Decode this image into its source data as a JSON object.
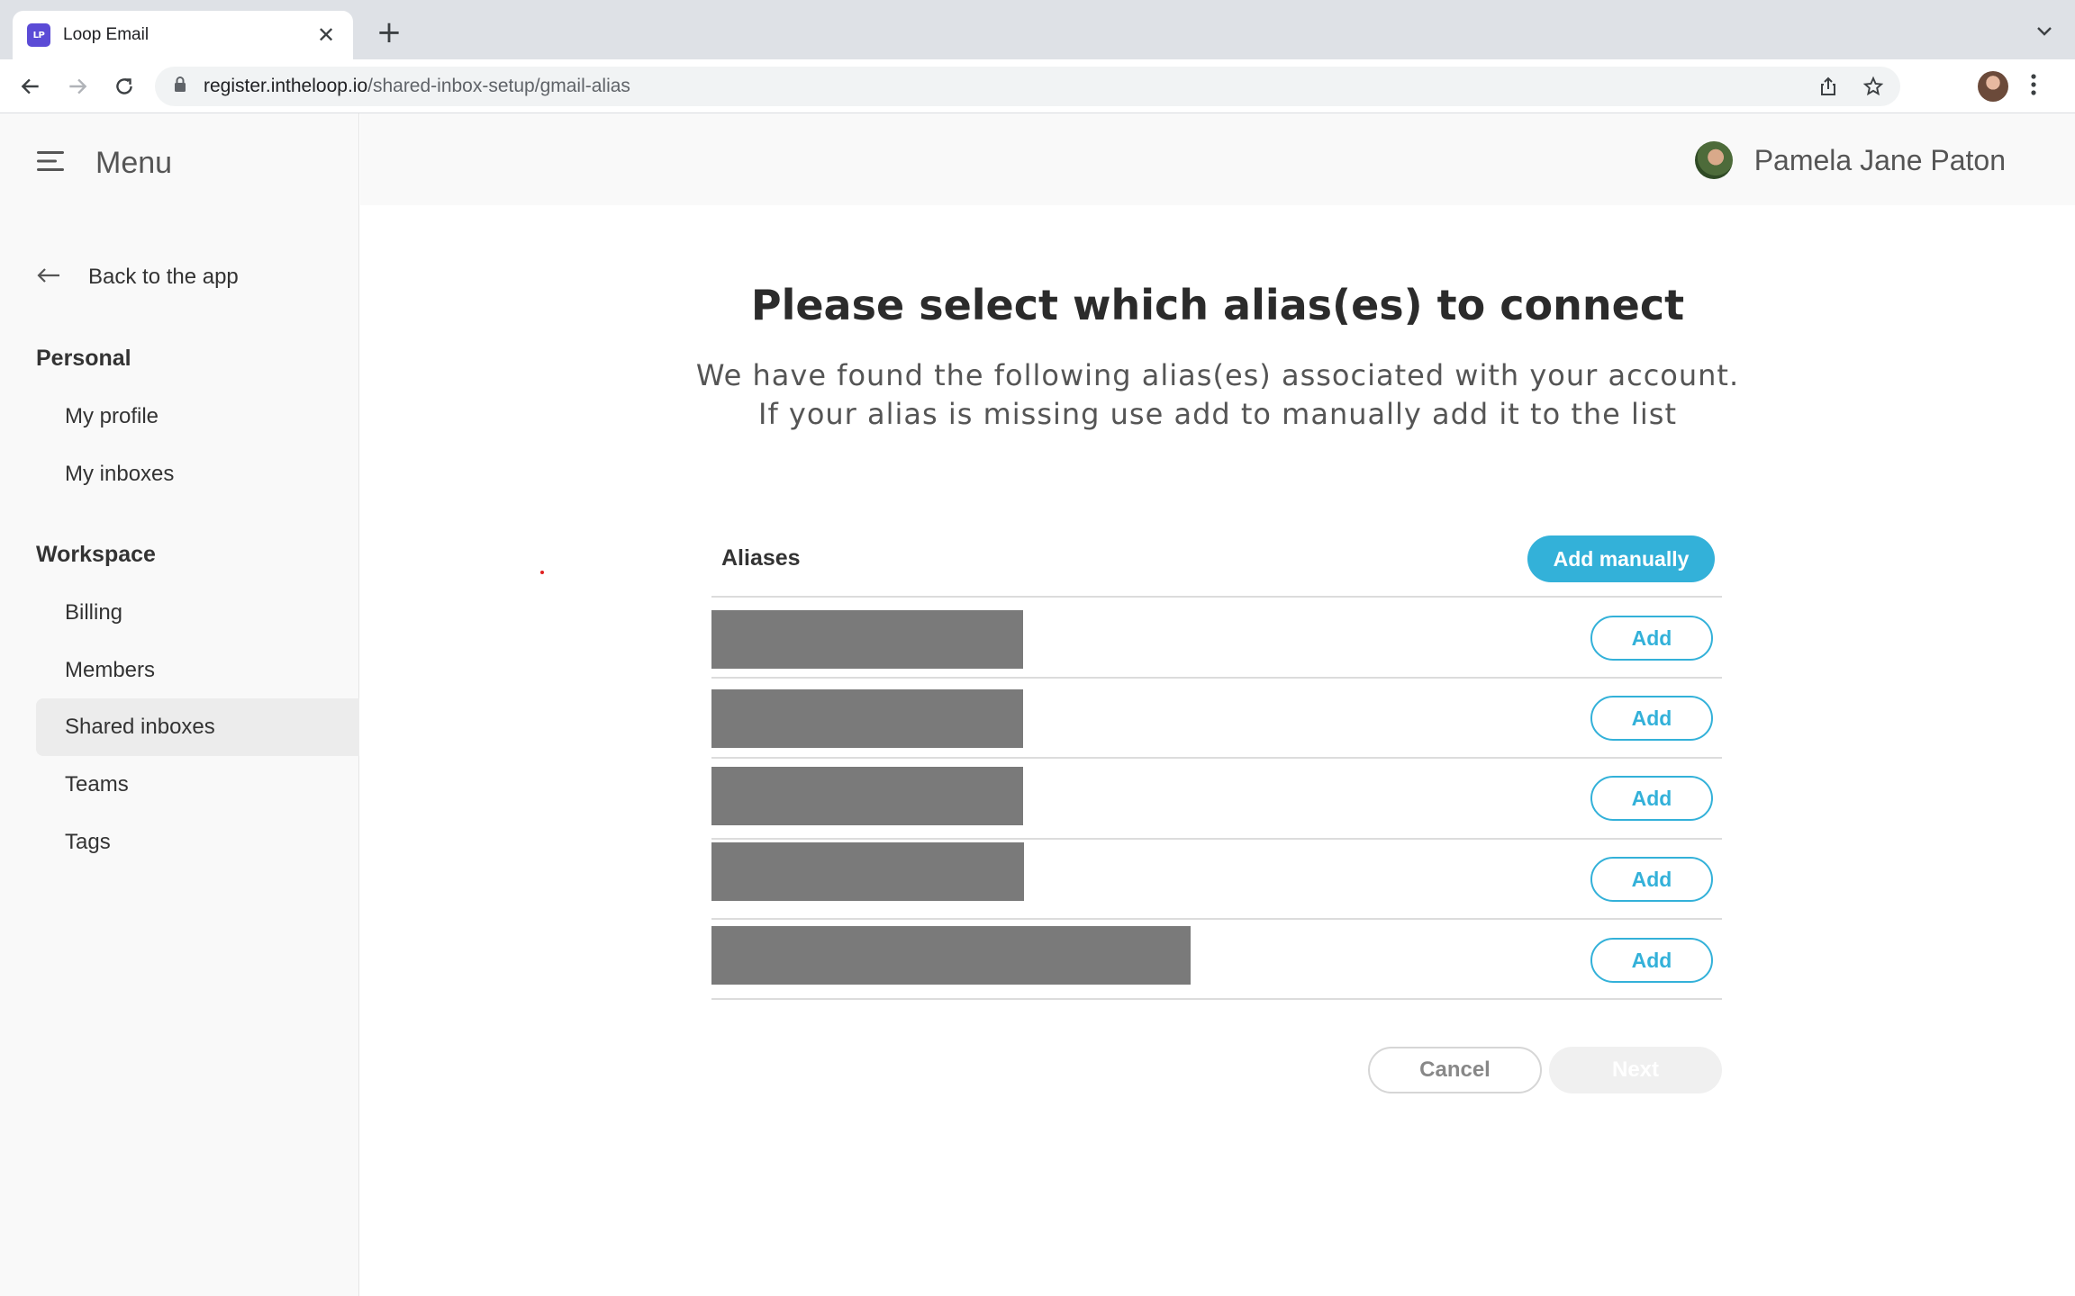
{
  "browser": {
    "tab_title": "Loop Email",
    "favicon_text": "LP",
    "url_host": "register.intheloop.io",
    "url_path": "/shared-inbox-setup/gmail-alias"
  },
  "sidebar": {
    "menu_label": "Menu",
    "back_label": "Back to the app",
    "sections": {
      "personal": "Personal",
      "workspace": "Workspace"
    },
    "items": {
      "my_profile": "My profile",
      "my_inboxes": "My inboxes",
      "billing": "Billing",
      "members": "Members",
      "shared_inboxes": "Shared inboxes",
      "teams": "Teams",
      "tags": "Tags"
    },
    "active_item": "Shared inboxes"
  },
  "header": {
    "user_name": "Pamela Jane Paton"
  },
  "main": {
    "title": "Please select which alias(es) to connect",
    "subtitle_line1": "We have found the following alias(es) associated with your account.",
    "subtitle_line2": "If your alias is missing use add to manually add it to the list",
    "aliases_label": "Aliases",
    "add_manually_label": "Add manually",
    "alias_rows": [
      {
        "add_label": "Add"
      },
      {
        "add_label": "Add"
      },
      {
        "add_label": "Add"
      },
      {
        "add_label": "Add"
      },
      {
        "add_label": "Add"
      }
    ],
    "cancel_label": "Cancel",
    "next_label": "Next"
  },
  "colors": {
    "accent": "#33b1d9",
    "redaction": "#7a7a7a",
    "sidebar_bg": "#f9f9f9"
  }
}
